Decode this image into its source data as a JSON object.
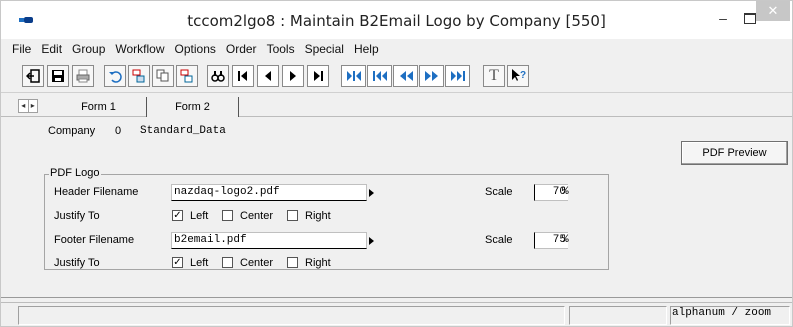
{
  "window": {
    "title": "tccom2lgo8 : Maintain B2Email Logo by Company [550]",
    "minimize": "–",
    "close": "✕"
  },
  "menu": [
    "File",
    "Edit",
    "Group",
    "Workflow",
    "Options",
    "Order",
    "Tools",
    "Special",
    "Help"
  ],
  "toolbar": {
    "text_button": "T",
    "help_button": "?"
  },
  "tabs": [
    "Form 1",
    "Form 2"
  ],
  "company": {
    "label": "Company",
    "number": "0",
    "name": "Standard_Data"
  },
  "pdf_preview_label": "PDF Preview",
  "pdf_logo": {
    "legend": "PDF Logo",
    "header_label": "Header Filename",
    "header_value": "nazdaq-logo2.pdf",
    "header_scale_label": "Scale",
    "header_scale": "70",
    "footer_label": "Footer Filename",
    "footer_value": "b2email.pdf",
    "footer_scale_label": "Scale",
    "footer_scale": "75",
    "percent": "%",
    "justify_label": "Justify To",
    "justify_options": [
      "Left",
      "Center",
      "Right"
    ],
    "checkmark": "✓"
  },
  "status": {
    "mode": "alphanum / zoom"
  },
  "colors": {
    "accent": "#1e6fc2",
    "close_button": "#c7c7c7"
  }
}
